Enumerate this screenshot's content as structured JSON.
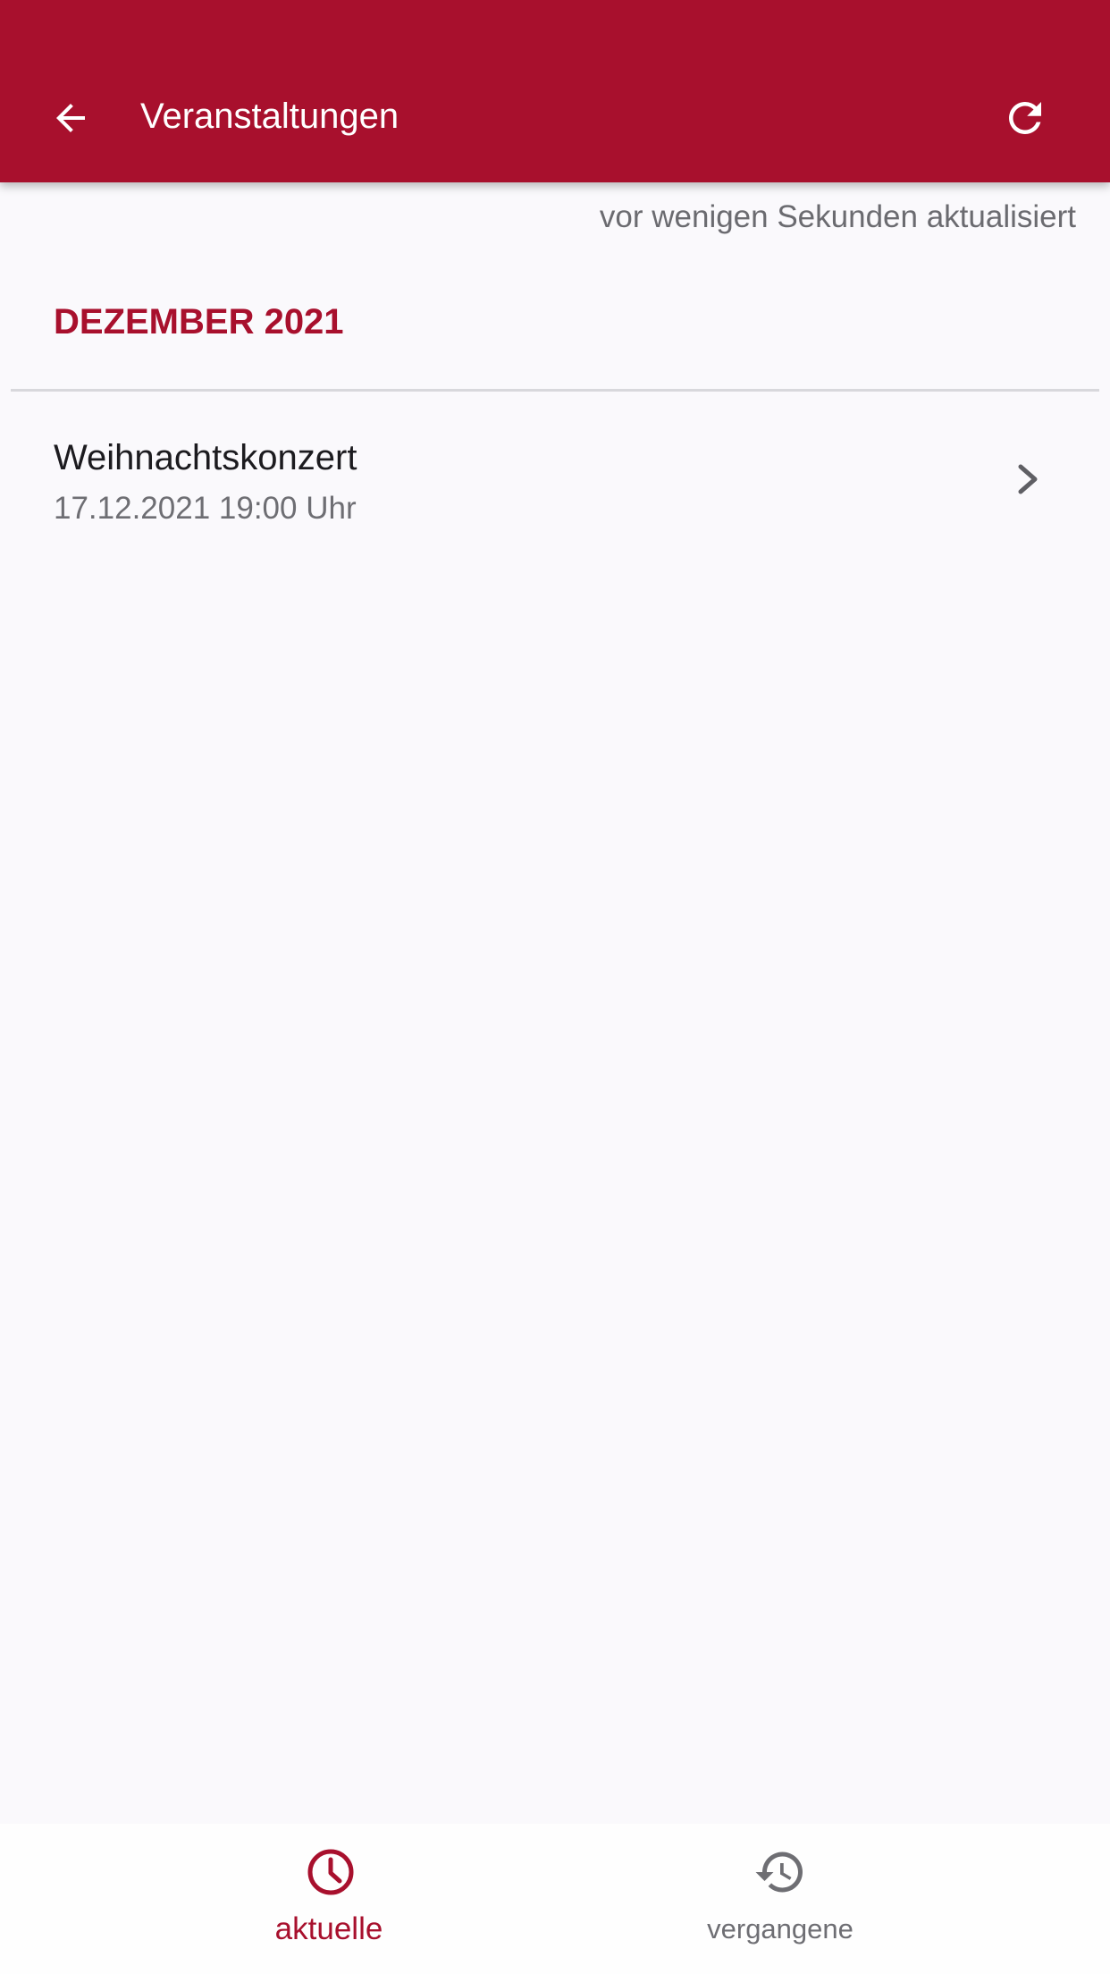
{
  "app_bar": {
    "title": "Veranstaltungen",
    "back_icon": "arrow-left-icon",
    "refresh_icon": "refresh-icon",
    "background_color": "#a8102d"
  },
  "status": {
    "last_updated": "vor wenigen Sekunden aktualisiert"
  },
  "events": {
    "sections": [
      {
        "heading": "DEZEMBER 2021",
        "items": [
          {
            "title": "Weihnachtskonzert",
            "datetime": "17.12.2021 19:00 Uhr",
            "icon": "chevron-right-icon"
          }
        ]
      }
    ]
  },
  "bottom_nav": {
    "items": [
      {
        "label": "aktuelle",
        "icon": "clock-icon",
        "active": true
      },
      {
        "label": "vergangene",
        "icon": "history-icon",
        "active": false
      }
    ],
    "active_color": "#a8102d",
    "inactive_color": "#6e6e73"
  }
}
